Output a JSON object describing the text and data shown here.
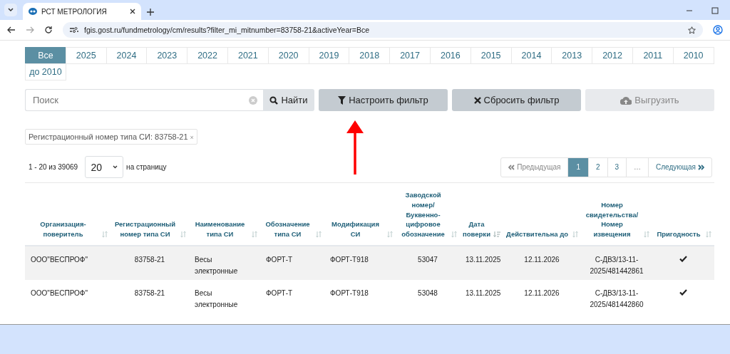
{
  "browser": {
    "tab_title": "РСТ МЕТРОЛОГИЯ",
    "url": "fgis.gost.ru/fundmetrology/cm/results?filter_mi_mitnumber=83758-21&activeYear=Все"
  },
  "years": [
    {
      "label": "Все",
      "selected": true
    },
    {
      "label": "2025",
      "selected": false
    },
    {
      "label": "2024",
      "selected": false
    },
    {
      "label": "2023",
      "selected": false
    },
    {
      "label": "2022",
      "selected": false
    },
    {
      "label": "2021",
      "selected": false
    },
    {
      "label": "2020",
      "selected": false
    },
    {
      "label": "2019",
      "selected": false
    },
    {
      "label": "2018",
      "selected": false
    },
    {
      "label": "2017",
      "selected": false
    },
    {
      "label": "2016",
      "selected": false
    },
    {
      "label": "2015",
      "selected": false
    },
    {
      "label": "2014",
      "selected": false
    },
    {
      "label": "2013",
      "selected": false
    },
    {
      "label": "2012",
      "selected": false
    },
    {
      "label": "2011",
      "selected": false
    },
    {
      "label": "2010",
      "selected": false
    },
    {
      "label": "до 2010",
      "selected": false
    }
  ],
  "search": {
    "placeholder": "Поиск",
    "button": "Найти"
  },
  "actions": [
    {
      "kind": "filter",
      "label": "Настроить фильтр",
      "disabled": false
    },
    {
      "kind": "reset",
      "label": "Сбросить фильтр",
      "disabled": false
    },
    {
      "kind": "export",
      "label": "Выгрузить",
      "disabled": true
    }
  ],
  "filter_chip": {
    "label": "Регистрационный номер типа СИ: 83758-21",
    "remove": "×"
  },
  "summary": {
    "range": "1 - 20 из 39069",
    "page_size": "20",
    "per_page_label": "на страницу"
  },
  "pagination": [
    {
      "kind": "prev",
      "label": "Предыдущая",
      "selected": false,
      "disabled": true
    },
    {
      "kind": "page",
      "label": "1",
      "selected": true,
      "disabled": false
    },
    {
      "kind": "page",
      "label": "2",
      "selected": false,
      "disabled": false
    },
    {
      "kind": "page",
      "label": "3",
      "selected": false,
      "disabled": false
    },
    {
      "kind": "page",
      "label": "…",
      "selected": false,
      "disabled": true
    },
    {
      "kind": "next",
      "label": "Следующая",
      "selected": false,
      "disabled": false
    }
  ],
  "table": {
    "columns": [
      {
        "label": "Организация-поверитель",
        "sorted": false
      },
      {
        "label": "Регистрационный номер типа СИ",
        "sorted": false
      },
      {
        "label": "Наименование типа СИ",
        "sorted": false
      },
      {
        "label": "Обозначение типа СИ",
        "sorted": false
      },
      {
        "label": "Модификация СИ",
        "sorted": false
      },
      {
        "label": "Заводской номер/ Буквенно-цифровое обозначение",
        "sorted": false
      },
      {
        "label": "Дата поверки",
        "sorted": true
      },
      {
        "label": "Действительна до",
        "sorted": false
      },
      {
        "label": "Номер свидетельства/ Номер извещения",
        "sorted": false
      },
      {
        "label": "Пригодность",
        "sorted": false
      }
    ],
    "rows": [
      {
        "cells": [
          "ООО\"ВЕСПРОФ\"",
          "83758-21",
          "Весы электронные",
          "ФОРТ-Т",
          "ФОРТ-Т918",
          "53047",
          "13.11.2025",
          "12.11.2026",
          "С-ДВЗ/13-11-2025/481442861"
        ],
        "suitable": true
      },
      {
        "cells": [
          "ООО\"ВЕСПРОФ\"",
          "83758-21",
          "Весы электронные",
          "ФОРТ-Т",
          "ФОРТ-Т918",
          "53048",
          "13.11.2025",
          "12.11.2026",
          "С-ДВЗ/13-11-2025/481442860"
        ],
        "suitable": true
      }
    ]
  }
}
